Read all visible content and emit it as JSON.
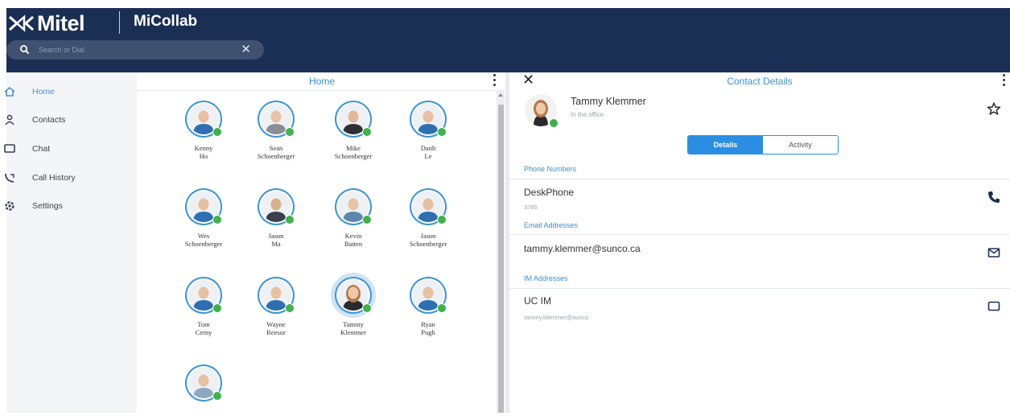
{
  "header": {
    "brand": "Mitel",
    "app_name": "MiCollab",
    "bg_color": "#1b2f55",
    "search": {
      "placeholder": "Search or Dial",
      "clear_icon": "close-icon"
    }
  },
  "sidebar": {
    "items": [
      {
        "label": "Home",
        "icon": "home-icon",
        "active": true
      },
      {
        "label": "Contacts",
        "icon": "contacts-icon",
        "active": false
      },
      {
        "label": "Chat",
        "icon": "chat-icon",
        "active": false
      },
      {
        "label": "Call History",
        "icon": "call-history-icon",
        "active": false
      },
      {
        "label": "Settings",
        "icon": "settings-icon",
        "active": false
      }
    ]
  },
  "home": {
    "title": "Home",
    "contacts": [
      {
        "first": "Kenny",
        "last": "Ho"
      },
      {
        "first": "Sean",
        "last": "Schoenberger"
      },
      {
        "first": "Mike",
        "last": "Schoenberger"
      },
      {
        "first": "Danh",
        "last": "Le"
      },
      {
        "first": "Wes",
        "last": "Schoenberger"
      },
      {
        "first": "Jason",
        "last": "Ma"
      },
      {
        "first": "Kevin",
        "last": "Batten"
      },
      {
        "first": "Jason",
        "last": "Schoenberger"
      },
      {
        "first": "Tom",
        "last": "Cerny"
      },
      {
        "first": "Wayne",
        "last": "Reesor"
      },
      {
        "first": "Tammy",
        "last": "Klemmer"
      },
      {
        "first": "Ryan",
        "last": "Pugh"
      },
      {
        "first": "",
        "last": ""
      }
    ]
  },
  "details": {
    "title": "Contact Details",
    "close_icon": "close-icon",
    "name": "Tammy Klemmer",
    "status": "In the office",
    "tabs": {
      "details": "Details",
      "activity": "Activity",
      "active": "details"
    },
    "phone_header": "Phone Numbers",
    "phone": {
      "label": "DeskPhone",
      "number": "3786"
    },
    "email_header": "Email Addresses",
    "email": "tammy.klemmer@sunco.ca",
    "im_header": "IM Addresses",
    "im": {
      "label": "UC IM",
      "address": "tammy.klemmer@sunco"
    }
  },
  "colors": {
    "accent": "#2b8ee3",
    "presence": "#3fb24a"
  }
}
